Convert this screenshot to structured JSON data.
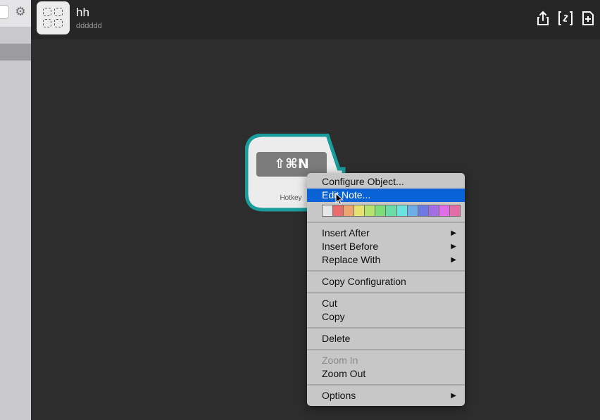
{
  "header": {
    "title": "hh",
    "subtitle": "dddddd"
  },
  "node": {
    "shortcut": "⇧⌘N",
    "label": "Hotkey",
    "accent": "#1a9b9c"
  },
  "menu": {
    "items": [
      {
        "label": "Configure Object..."
      },
      {
        "label": "Edit Note...",
        "selected": true
      },
      {
        "label": "Insert After",
        "submenu": true
      },
      {
        "label": "Insert Before",
        "submenu": true
      },
      {
        "label": "Replace With",
        "submenu": true
      },
      {
        "label": "Copy Configuration"
      },
      {
        "label": "Cut"
      },
      {
        "label": "Copy"
      },
      {
        "label": "Delete"
      },
      {
        "label": "Zoom In",
        "disabled": true
      },
      {
        "label": "Zoom Out"
      },
      {
        "label": "Options",
        "submenu": true
      }
    ],
    "submenu_arrow": "▶",
    "colors": [
      "#e6e6e6",
      "#e86c6c",
      "#eba56e",
      "#e6e270",
      "#b6e36f",
      "#7ddd78",
      "#6bdca6",
      "#6be3df",
      "#6eaee6",
      "#6f78e0",
      "#a36ee4",
      "#e06ee6",
      "#e36ba6"
    ],
    "selection_color": "#0a63d6"
  },
  "icons": {
    "gear": "gear-icon",
    "share": "share-icon",
    "variable": "variable-icon",
    "add": "add-icon",
    "app": "app-grid-icon"
  }
}
